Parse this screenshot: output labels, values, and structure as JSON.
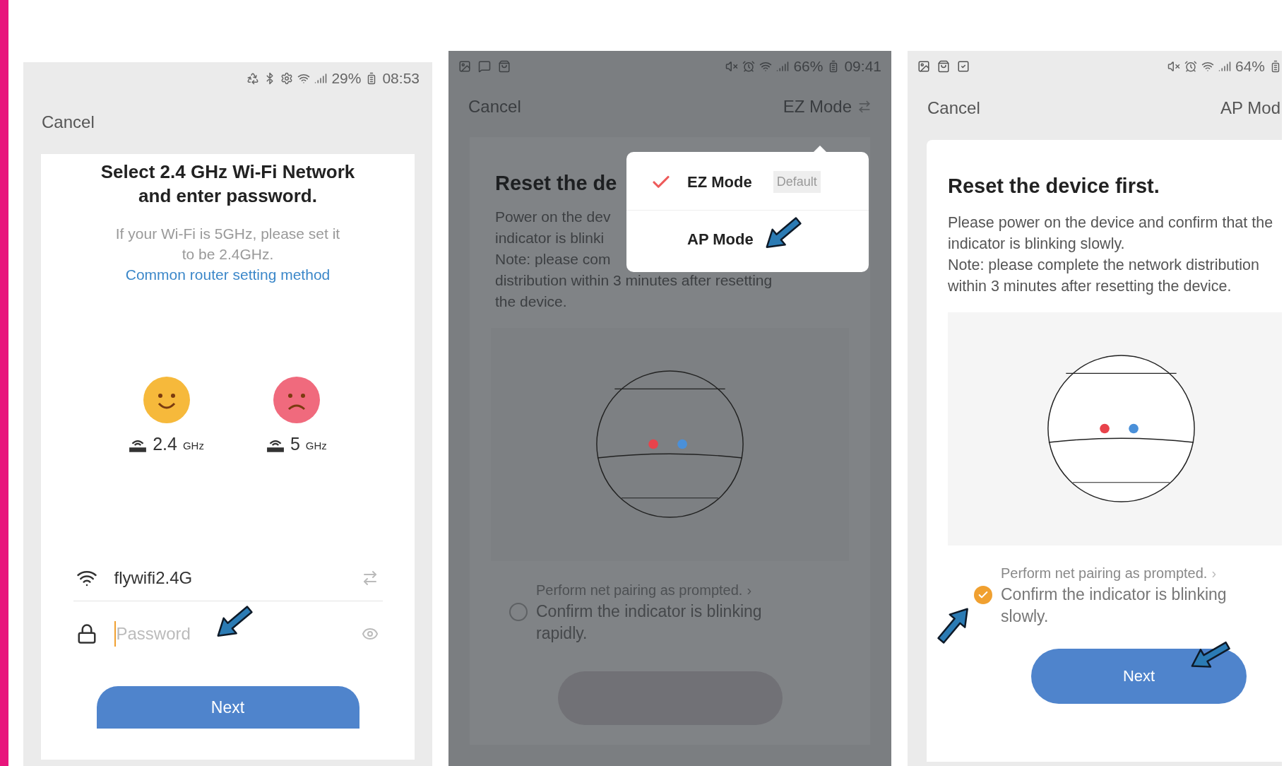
{
  "wifi_screen": {
    "status": {
      "battery": "29%",
      "time": "08:53"
    },
    "cancel": "Cancel",
    "title": "Select 2.4 GHz Wi-Fi Network and enter password.",
    "hint": "If your Wi-Fi is 5GHz, please set it to be 2.4GHz.",
    "link": "Common router setting method",
    "bands": [
      {
        "kind": "happy",
        "color": "#f6b93b",
        "value": "2.4",
        "unit": "GHz"
      },
      {
        "kind": "sad",
        "color": "#f06a7d",
        "value": "5",
        "unit": "GHz"
      }
    ],
    "network": "flywifi2.4G",
    "password": {
      "placeholder": "Password"
    },
    "next": "Next"
  },
  "ez_screen": {
    "status": {
      "battery": "66%",
      "time": "09:41"
    },
    "cancel": "Cancel",
    "mode": "EZ Mode",
    "title": "Reset the de",
    "body_lines": [
      "Power on the dev",
      "indicator is blinki",
      "Note: please com",
      "distribution within 3 minutes after resetting",
      "the device."
    ],
    "step": {
      "prompt": "Perform net pairing as prompted.",
      "chevron": "›",
      "confirm": "Confirm the indicator is blinking rapidly.",
      "checked": false
    },
    "menu": [
      {
        "label": "EZ Mode",
        "badge": "Default",
        "selected": true
      },
      {
        "label": "AP Mode",
        "selected": false
      }
    ]
  },
  "ap_screen": {
    "status": {
      "battery": "64%"
    },
    "cancel": "Cancel",
    "mode": "AP Mod",
    "title": "Reset the device first.",
    "body": "Please power on the device and confirm that the indicator is blinking slowly.",
    "note": "Note: please complete the network distribution within 3 minutes after resetting the device.",
    "step": {
      "prompt": "Perform net pairing as prompted.",
      "chevron": "›",
      "confirm": "Confirm the indicator is blinking slowly.",
      "checked": true
    },
    "next": "Next"
  }
}
